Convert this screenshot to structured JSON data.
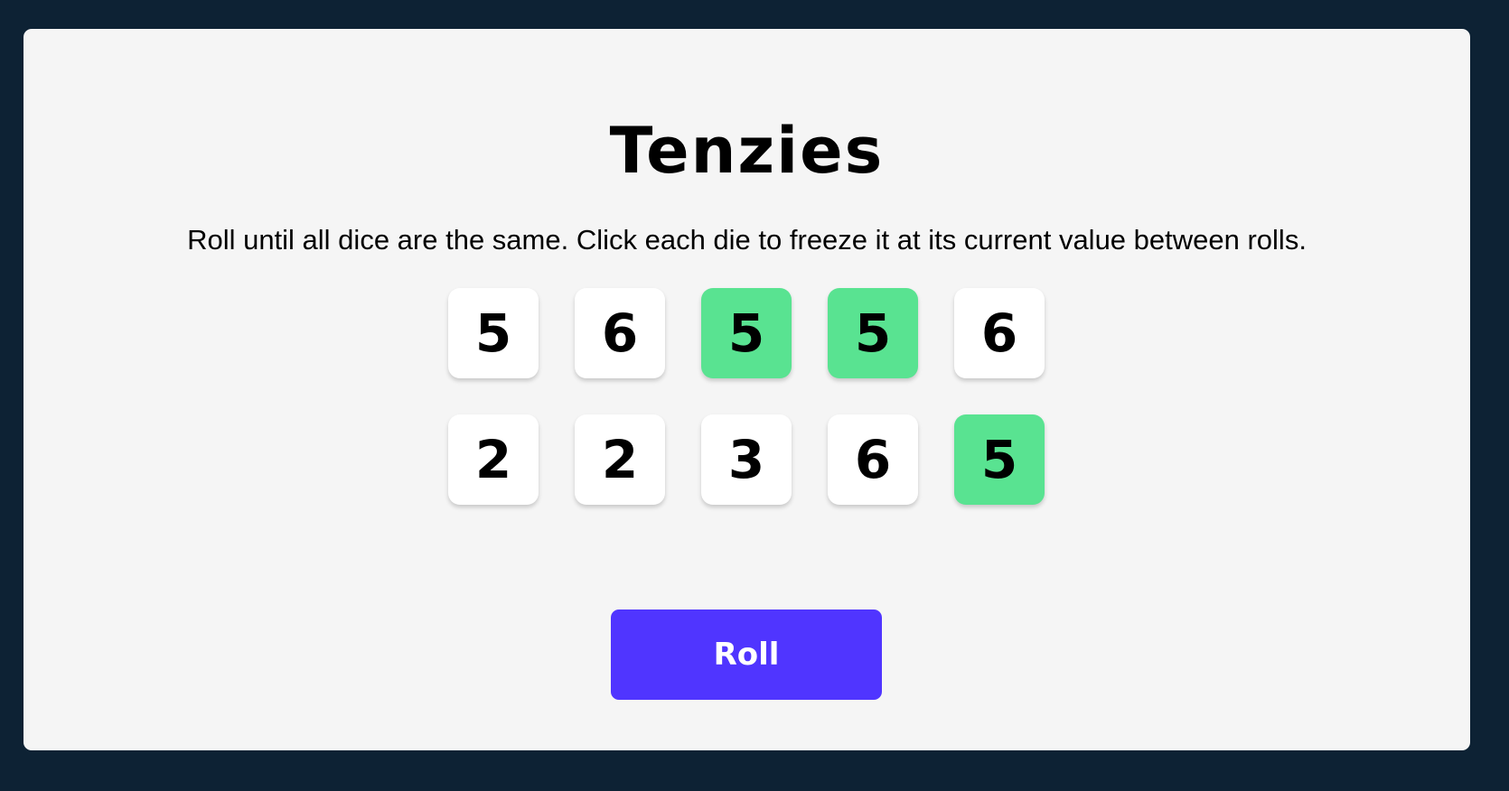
{
  "game": {
    "title": "Tenzies",
    "instructions": "Roll until all dice are the same. Click each die to freeze it at its current value between rolls."
  },
  "colors": {
    "page_background": "#0d2234",
    "board_background": "#f5f5f5",
    "die_face": "#ffffff",
    "held_die": "#59e391",
    "roll_button": "#5035ff"
  },
  "dice": [
    {
      "value": "5",
      "held": false
    },
    {
      "value": "6",
      "held": false
    },
    {
      "value": "5",
      "held": true
    },
    {
      "value": "5",
      "held": true
    },
    {
      "value": "6",
      "held": false
    },
    {
      "value": "2",
      "held": false
    },
    {
      "value": "2",
      "held": false
    },
    {
      "value": "3",
      "held": false
    },
    {
      "value": "6",
      "held": false
    },
    {
      "value": "5",
      "held": true
    }
  ],
  "controls": {
    "roll_label": "Roll"
  }
}
